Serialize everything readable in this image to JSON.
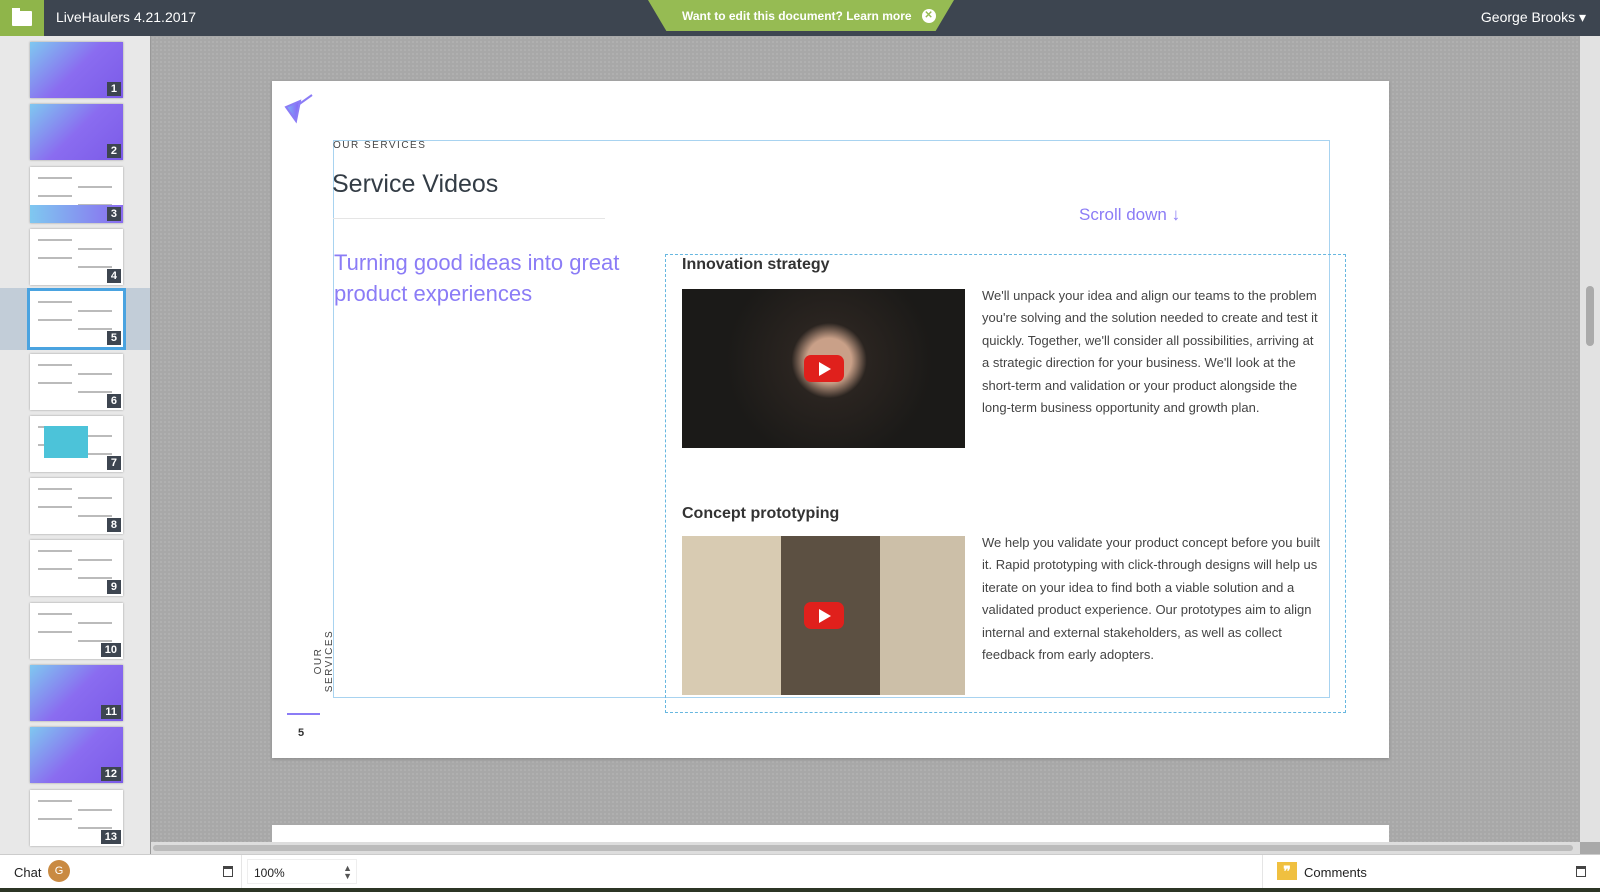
{
  "topbar": {
    "title": "LiveHaulers 4.21.2017",
    "banner": "Want to edit this document? Learn more",
    "user": "George Brooks ▾"
  },
  "sidebar": {
    "slides": [
      "1",
      "2",
      "3",
      "4",
      "5",
      "6",
      "7",
      "8",
      "9",
      "10",
      "11",
      "12",
      "13"
    ],
    "selected": "5"
  },
  "slide": {
    "eyebrow": "OUR SERVICES",
    "title": "Service Videos",
    "lead": "Turning good ideas into great product experiences",
    "scroll": "Scroll down ↓",
    "sections": [
      {
        "title": "Innovation strategy",
        "body": "We'll unpack your idea and align our teams to the problem you're solving and the solution needed to create and test it quickly. Together, we'll consider all possibilities, arriving at a strategic direction for your business. We'll look at the short-term and validation or your product alongside the long-term business opportunity and growth plan."
      },
      {
        "title": "Concept prototyping",
        "body": "We help you validate your product concept before you built it. Rapid prototyping with click-through designs will help us iterate on your idea to find both a viable solution and a validated product experience. Our prototypes aim to align internal and external stakeholders, as well as collect feedback from early adopters."
      }
    ],
    "side_label": "OUR SERVICES",
    "page_number": "5"
  },
  "bottombar": {
    "chat": "Chat",
    "avatar": "G",
    "zoom": "100%",
    "comments": "Comments"
  },
  "colors": {
    "accent": "#8b7cf6",
    "topbar": "#3d4550",
    "green": "#96bb53"
  }
}
